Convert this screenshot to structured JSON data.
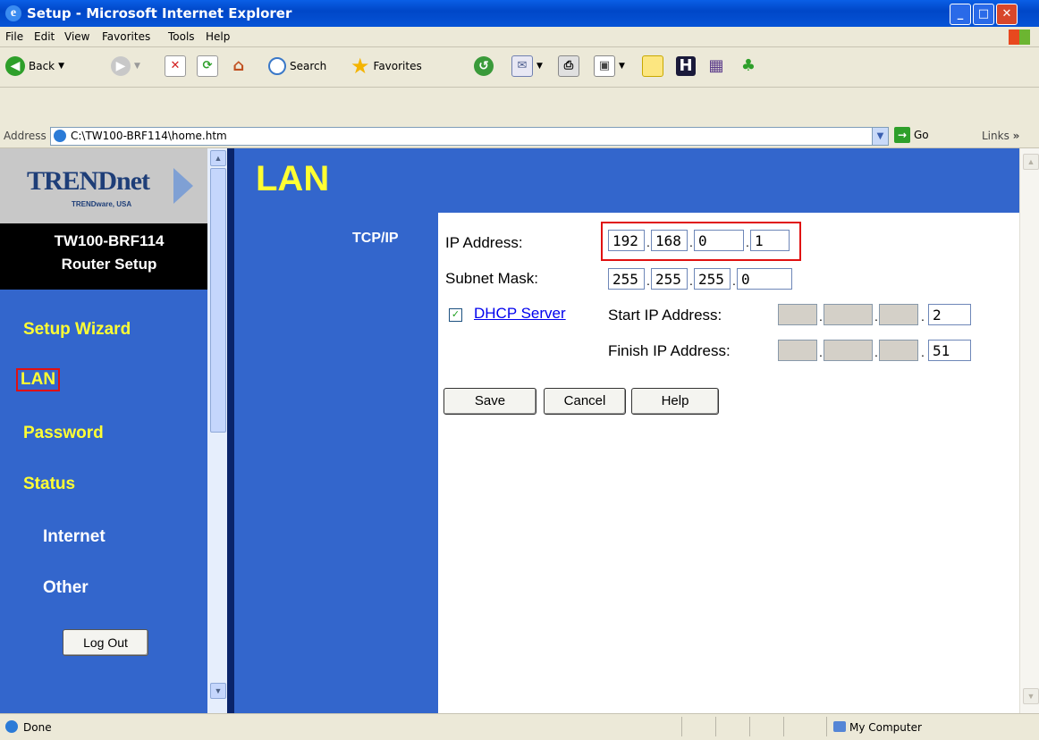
{
  "window": {
    "title": "Setup - Microsoft Internet Explorer",
    "buttons": {
      "minimize": "_",
      "maximize": "□",
      "close": "✕"
    }
  },
  "menu": [
    "File",
    "Edit",
    "View",
    "Favorites",
    "Tools",
    "Help"
  ],
  "toolbar": {
    "back": "Back",
    "search": "Search",
    "favorites": "Favorites"
  },
  "address": {
    "label": "Address",
    "url": "C:\\TW100-BRF114\\home.htm",
    "go": "Go",
    "links": "Links"
  },
  "sidebar": {
    "logo": "TRENDnet",
    "logo_sub": "TRENDware, USA",
    "model": "TW100-BRF114",
    "subtitle": "Router Setup",
    "items": [
      {
        "label": "Setup Wizard"
      },
      {
        "label": "LAN"
      },
      {
        "label": "Password"
      },
      {
        "label": "Status"
      },
      {
        "label": "Internet"
      },
      {
        "label": "Other"
      }
    ],
    "logout": "Log Out"
  },
  "page": {
    "title": "LAN",
    "section": "TCP/IP",
    "ip_label": "IP Address:",
    "ip": [
      "192",
      "168",
      "0",
      "1"
    ],
    "mask_label": "Subnet Mask:",
    "mask": [
      "255",
      "255",
      "255",
      "0"
    ],
    "dhcp_checked": true,
    "dhcp_link": "DHCP Server",
    "start_label": "Start IP Address:",
    "start_last": "2",
    "finish_label": "Finish IP Address:",
    "finish_last": "51",
    "buttons": {
      "save": "Save",
      "cancel": "Cancel",
      "help": "Help"
    }
  },
  "statusbar": {
    "text": "Done",
    "zone": "My Computer"
  },
  "colors": {
    "frame_blue": "#3366CC",
    "nav_yellow": "#FFFF33",
    "highlight_red": "#E01010"
  }
}
